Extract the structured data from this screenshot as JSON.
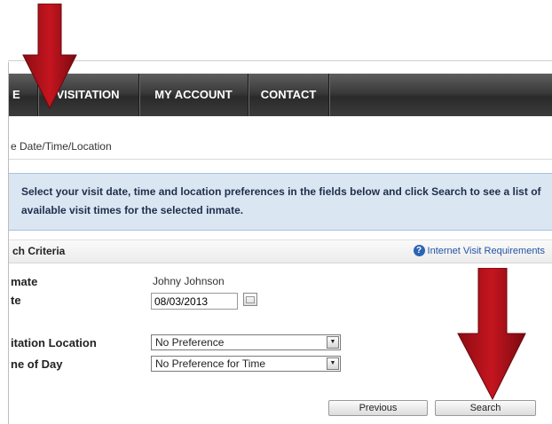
{
  "nav": {
    "items": [
      {
        "label": "E"
      },
      {
        "label": "VISITATION"
      },
      {
        "label": "MY ACCOUNT"
      },
      {
        "label": "CONTACT"
      }
    ]
  },
  "breadcrumb": "e Date/Time/Location",
  "info_box": {
    "text": "Select your visit date, time and location preferences in the fields below and click Search to see a list of available visit times for the selected inmate."
  },
  "criteria": {
    "title": "ch Criteria",
    "help_link": "Internet Visit Requirements"
  },
  "form": {
    "inmate_label": "mate",
    "inmate_value": "Johny Johnson",
    "date_label": "te",
    "date_value": "08/03/2013",
    "location_label": "itation Location",
    "location_value": "No Preference",
    "time_label": "ne of Day",
    "time_value": "No Preference for Time"
  },
  "buttons": {
    "previous": "Previous",
    "search": "Search"
  },
  "colors": {
    "annotation_arrow": "#b3121b",
    "nav_bg": "#3a3a3a",
    "info_bg": "#dbe6f3"
  }
}
